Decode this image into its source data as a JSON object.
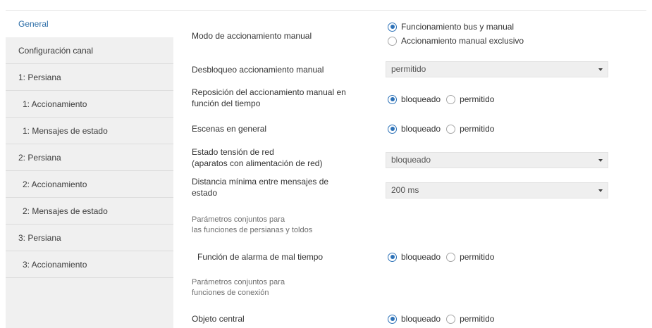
{
  "sidebar": {
    "items": [
      {
        "label": "General"
      },
      {
        "label": "Configuración canal"
      },
      {
        "label": "1: Persiana"
      },
      {
        "label": "1: Accionamiento"
      },
      {
        "label": "1: Mensajes de estado"
      },
      {
        "label": "2: Persiana"
      },
      {
        "label": "2: Accionamiento"
      },
      {
        "label": "2: Mensajes de estado"
      },
      {
        "label": "3: Persiana"
      },
      {
        "label": "3: Accionamiento"
      }
    ]
  },
  "params": {
    "manual_mode": {
      "label": "Modo de accionamiento manual",
      "options": [
        "Funcionamiento bus y manual",
        "Accionamiento manual exclusivo"
      ],
      "selected": "Funcionamiento bus y manual"
    },
    "manual_unlock": {
      "label": "Desbloqueo accionamiento manual",
      "value": "permitido"
    },
    "manual_reset": {
      "label_line1": "Reposición del accionamiento manual en",
      "label_line2": "función del tiempo",
      "options": [
        "bloqueado",
        "permitido"
      ],
      "selected": "bloqueado"
    },
    "scenes": {
      "label": "Escenas en general",
      "options": [
        "bloqueado",
        "permitido"
      ],
      "selected": "bloqueado"
    },
    "mains_status": {
      "label_line1": "Estado tensión de red",
      "label_line2": "(aparatos con alimentación de red)",
      "value": "bloqueado"
    },
    "min_distance": {
      "label_line1": "Distancia mínima entre mensajes de",
      "label_line2": "estado",
      "value": "200 ms"
    },
    "section_blinds": {
      "line1": "Parámetros conjuntos para",
      "line2": "las funciones de persianas y toldos"
    },
    "weather_alarm": {
      "label": "Función de alarma de mal tiempo",
      "options": [
        "bloqueado",
        "permitido"
      ],
      "selected": "bloqueado"
    },
    "section_connection": {
      "line1": "Parámetros conjuntos para",
      "line2": "funciones de conexión"
    },
    "central_object": {
      "label": "Objeto central",
      "options": [
        "bloqueado",
        "permitido"
      ],
      "selected": "bloqueado"
    }
  },
  "colors": {
    "accent": "#2d72b8",
    "active_nav_text": "#2f6fa8",
    "sidebar_bg": "#f0f0f0",
    "dropdown_bg": "#efefef"
  },
  "icons": {
    "dropdown": "caret-down-icon",
    "radio": "radio-icon"
  }
}
